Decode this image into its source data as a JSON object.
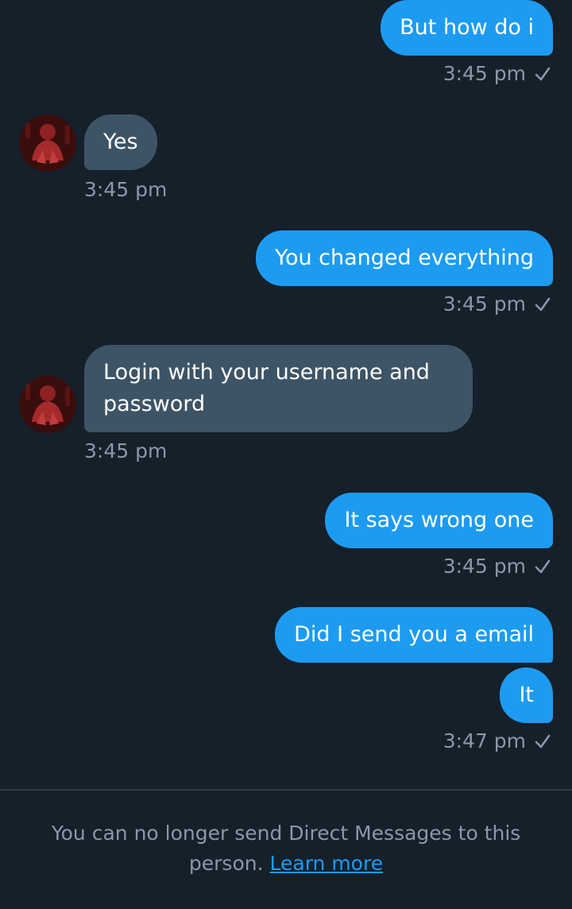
{
  "messages": [
    {
      "type": "sent",
      "text": "But how do i",
      "time": "3:45 pm"
    },
    {
      "type": "received",
      "text": "Yes",
      "time": "3:45 pm"
    },
    {
      "type": "sent",
      "text": "You changed everything",
      "time": "3:45 pm"
    },
    {
      "type": "received",
      "text": "Login with your username and password",
      "time": "3:45 pm"
    },
    {
      "type": "sent",
      "text": "It says wrong one",
      "time": "3:45 pm"
    },
    {
      "type": "sent",
      "text": "Did I send you a email"
    },
    {
      "type": "sent",
      "text": "It",
      "time": "3:47 pm"
    }
  ],
  "footer": {
    "notice": "You can no longer send Direct Messages to this",
    "notice_cont": "person.",
    "link": "Learn more"
  },
  "colors": {
    "background": "#15202b",
    "sent_bubble": "#1d9bf0",
    "received_bubble": "#3d5466",
    "muted_text": "#8b98a5",
    "link": "#1d9bf0"
  },
  "icons": {
    "avatar": "contact-avatar",
    "read_receipt": "check-icon"
  }
}
